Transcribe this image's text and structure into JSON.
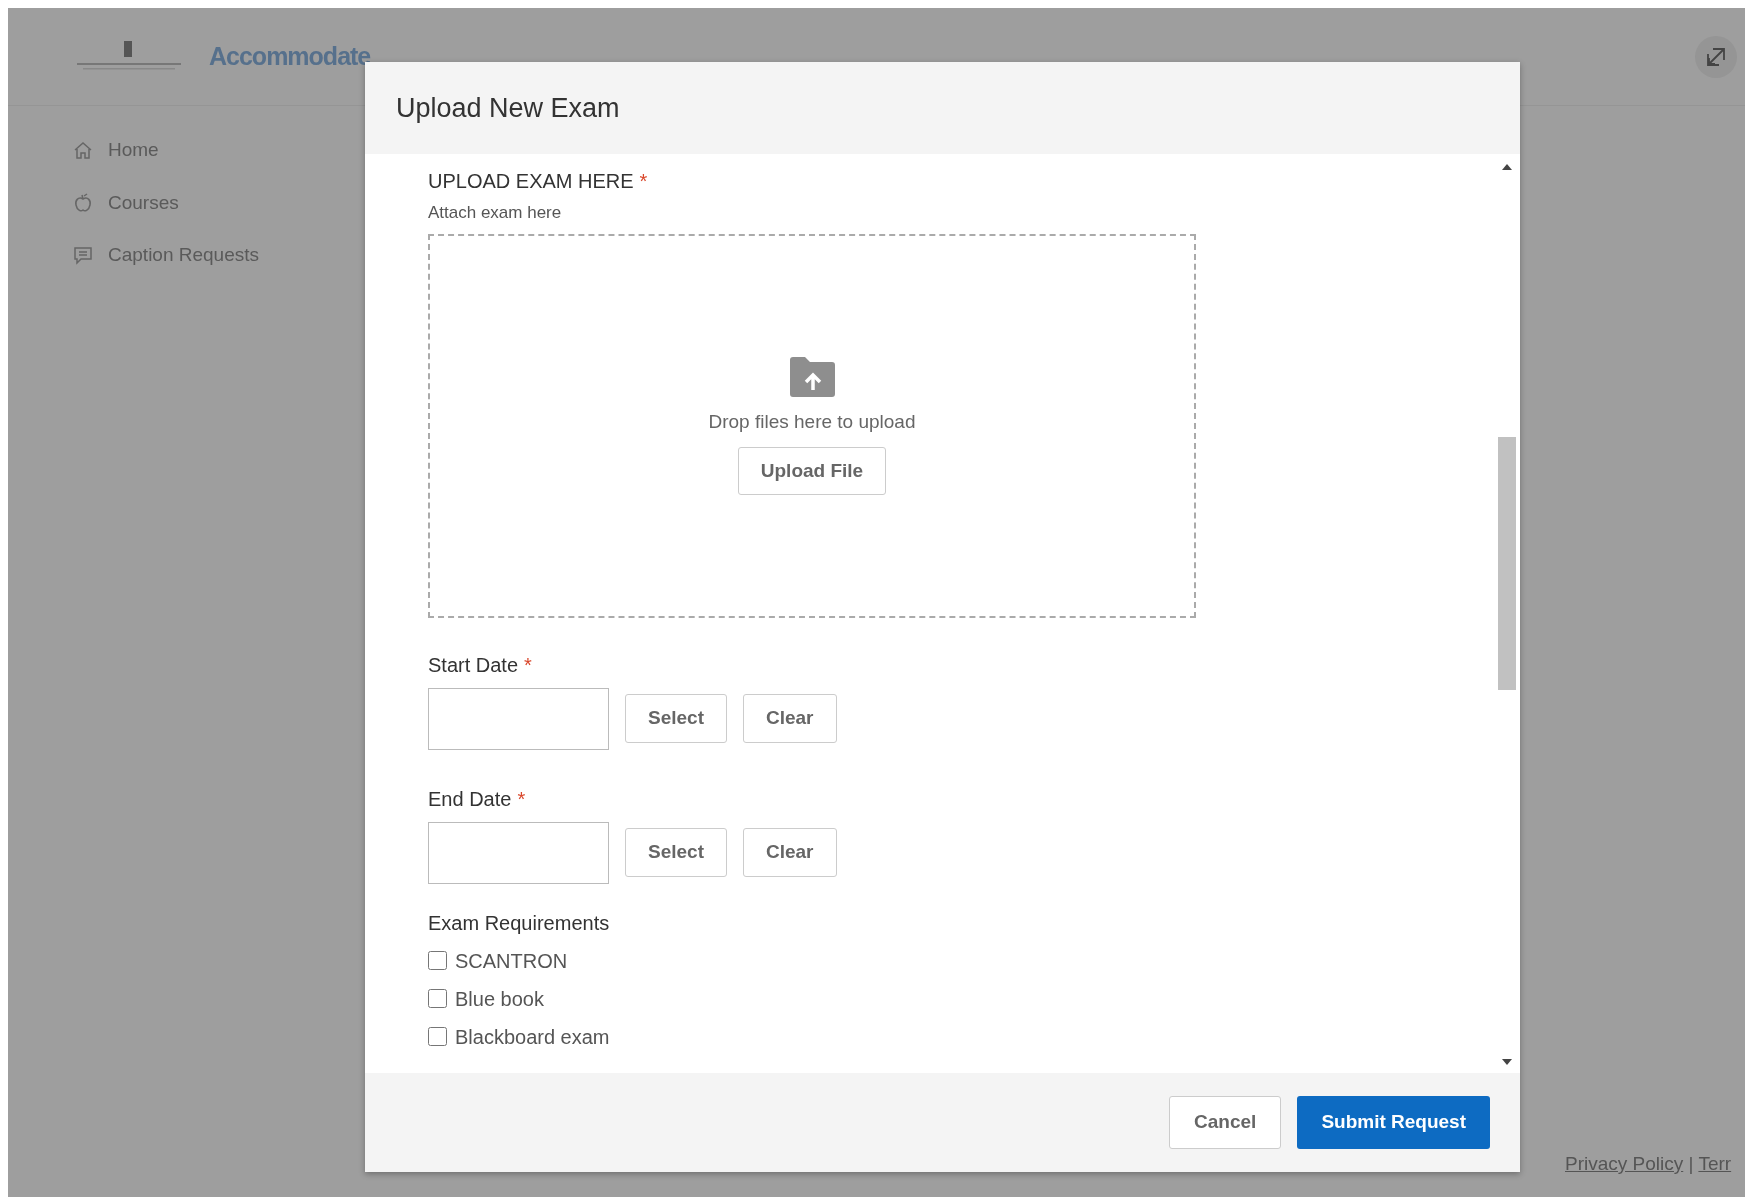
{
  "app": {
    "logo_text": "Accommodate"
  },
  "sidebar": {
    "items": [
      {
        "label": "Home",
        "kind": "home"
      },
      {
        "label": "Courses",
        "kind": "apple"
      },
      {
        "label": "Caption Requests",
        "kind": "chat"
      }
    ]
  },
  "modal": {
    "title": "Upload New Exam",
    "upload": {
      "label": "UPLOAD EXAM HERE",
      "required_mark": "*",
      "hint": "Attach exam here",
      "drop_text": "Drop files here to upload",
      "button": "Upload File"
    },
    "dates": [
      {
        "label": "Start Date",
        "required_mark": "*",
        "select": "Select",
        "clear": "Clear"
      },
      {
        "label": "End Date",
        "required_mark": "*",
        "select": "Select",
        "clear": "Clear"
      }
    ],
    "requirements": {
      "title": "Exam Requirements",
      "options": [
        {
          "label": "SCANTRON",
          "checked": false
        },
        {
          "label": "Blue book",
          "checked": false
        },
        {
          "label": "Blackboard exam",
          "checked": false
        }
      ]
    },
    "buttons": {
      "cancel": "Cancel",
      "submit": "Submit Request"
    }
  },
  "footer": {
    "links": [
      "Privacy Policy",
      "Terr"
    ],
    "separator": "|"
  }
}
